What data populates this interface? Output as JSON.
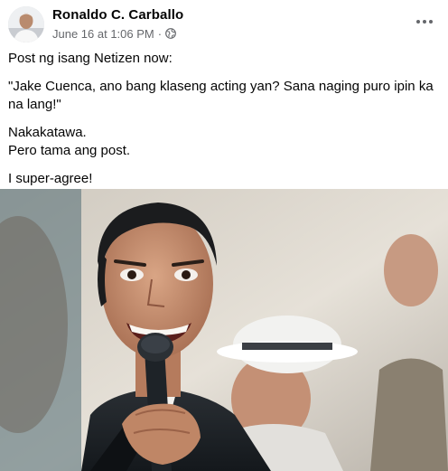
{
  "post": {
    "author": "Ronaldo C. Carballo",
    "timestamp": "June 16 at 1:06 PM",
    "separator": "·",
    "privacy_icon": "globe-icon",
    "more_icon": "more-options-icon",
    "paragraphs": [
      "Post ng isang Netizen now:",
      "\"Jake Cuenca, ano bang klaseng acting yan? Sana naging puro ipin ka na lang!\"",
      "Nakakatawa.",
      "Pero tama ang post.",
      "I super-agree!"
    ]
  },
  "colors": {
    "text": "#050505",
    "secondary": "#65676b"
  }
}
